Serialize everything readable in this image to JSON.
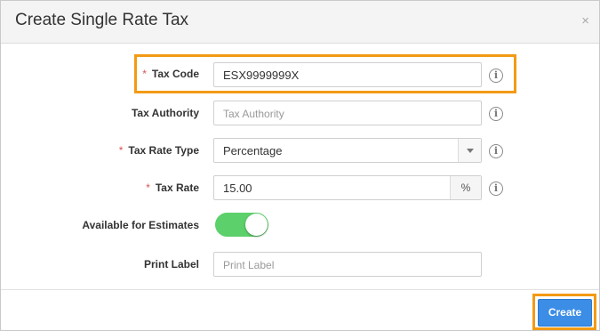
{
  "dialog": {
    "title": "Create Single Rate Tax",
    "close_glyph": "×"
  },
  "form": {
    "tax_code": {
      "label": "Tax Code",
      "required": true,
      "value": "ESX9999999X",
      "info_icon": "info-icon"
    },
    "tax_authority": {
      "label": "Tax Authority",
      "required": false,
      "placeholder": "Tax Authority",
      "value": "",
      "info_icon": "info-icon"
    },
    "tax_rate_type": {
      "label": "Tax Rate Type",
      "required": true,
      "selected": "Percentage",
      "info_icon": "info-icon"
    },
    "tax_rate": {
      "label": "Tax Rate",
      "required": true,
      "value": "15.00",
      "unit": "%",
      "info_icon": "info-icon"
    },
    "available_for_estimates": {
      "label": "Available for Estimates",
      "enabled": true,
      "on_color": "#5cd06b"
    },
    "print_label": {
      "label": "Print Label",
      "placeholder": "Print Label",
      "value": ""
    }
  },
  "required_marker": "*",
  "info_glyph": "i",
  "footer": {
    "create_label": "Create"
  },
  "colors": {
    "highlight": "#f39a14",
    "primary": "#3b8de6",
    "required": "#d9534f"
  }
}
